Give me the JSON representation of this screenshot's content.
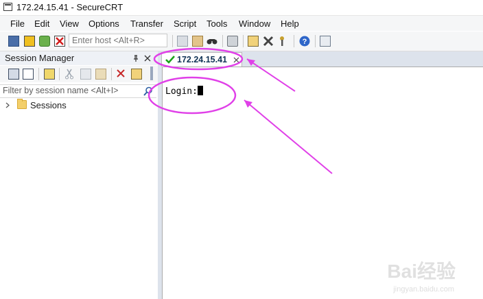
{
  "window": {
    "title": "172.24.15.41 - SecureCRT"
  },
  "menu": [
    "File",
    "Edit",
    "View",
    "Options",
    "Transfer",
    "Script",
    "Tools",
    "Window",
    "Help"
  ],
  "toolbar": {
    "quick_connect_placeholder": "Enter host <Alt+R>",
    "icons": [
      "connect-icon",
      "quick-connect-icon",
      "reconnect-icon",
      "disconnect-icon",
      "copy-icon",
      "paste-icon",
      "find-icon",
      "print-icon",
      "session-options-icon",
      "global-options-icon",
      "keymap-icon",
      "help-icon",
      "sftp-icon"
    ]
  },
  "session_manager": {
    "title": "Session Manager",
    "filter_placeholder": "Filter by session name <Alt+I>",
    "tree": [
      {
        "label": "Sessions",
        "expanded": false
      }
    ]
  },
  "tabs": [
    {
      "label": "172.24.15.41",
      "status": "connected",
      "active": true
    }
  ],
  "terminal": {
    "prompt": "Login:"
  },
  "colors": {
    "annotation": "#e040e8",
    "tab_check": "#1aa31a",
    "tab_label": "#113355"
  },
  "watermark": {
    "brand": "Bai经验",
    "url": "jingyan.baidu.com"
  }
}
